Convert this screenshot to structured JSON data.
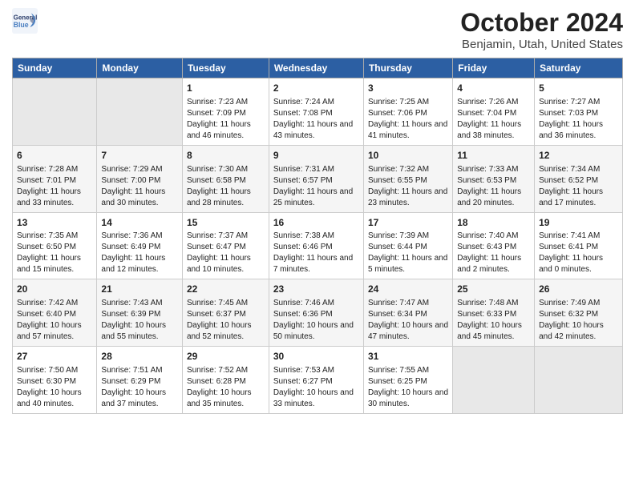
{
  "logo": {
    "text_general": "General",
    "text_blue": "Blue"
  },
  "title": "October 2024",
  "subtitle": "Benjamin, Utah, United States",
  "days_of_week": [
    "Sunday",
    "Monday",
    "Tuesday",
    "Wednesday",
    "Thursday",
    "Friday",
    "Saturday"
  ],
  "weeks": [
    [
      {
        "day": null,
        "sunrise": null,
        "sunset": null,
        "daylight": null
      },
      {
        "day": null,
        "sunrise": null,
        "sunset": null,
        "daylight": null
      },
      {
        "day": "1",
        "sunrise": "Sunrise: 7:23 AM",
        "sunset": "Sunset: 7:09 PM",
        "daylight": "Daylight: 11 hours and 46 minutes."
      },
      {
        "day": "2",
        "sunrise": "Sunrise: 7:24 AM",
        "sunset": "Sunset: 7:08 PM",
        "daylight": "Daylight: 11 hours and 43 minutes."
      },
      {
        "day": "3",
        "sunrise": "Sunrise: 7:25 AM",
        "sunset": "Sunset: 7:06 PM",
        "daylight": "Daylight: 11 hours and 41 minutes."
      },
      {
        "day": "4",
        "sunrise": "Sunrise: 7:26 AM",
        "sunset": "Sunset: 7:04 PM",
        "daylight": "Daylight: 11 hours and 38 minutes."
      },
      {
        "day": "5",
        "sunrise": "Sunrise: 7:27 AM",
        "sunset": "Sunset: 7:03 PM",
        "daylight": "Daylight: 11 hours and 36 minutes."
      }
    ],
    [
      {
        "day": "6",
        "sunrise": "Sunrise: 7:28 AM",
        "sunset": "Sunset: 7:01 PM",
        "daylight": "Daylight: 11 hours and 33 minutes."
      },
      {
        "day": "7",
        "sunrise": "Sunrise: 7:29 AM",
        "sunset": "Sunset: 7:00 PM",
        "daylight": "Daylight: 11 hours and 30 minutes."
      },
      {
        "day": "8",
        "sunrise": "Sunrise: 7:30 AM",
        "sunset": "Sunset: 6:58 PM",
        "daylight": "Daylight: 11 hours and 28 minutes."
      },
      {
        "day": "9",
        "sunrise": "Sunrise: 7:31 AM",
        "sunset": "Sunset: 6:57 PM",
        "daylight": "Daylight: 11 hours and 25 minutes."
      },
      {
        "day": "10",
        "sunrise": "Sunrise: 7:32 AM",
        "sunset": "Sunset: 6:55 PM",
        "daylight": "Daylight: 11 hours and 23 minutes."
      },
      {
        "day": "11",
        "sunrise": "Sunrise: 7:33 AM",
        "sunset": "Sunset: 6:53 PM",
        "daylight": "Daylight: 11 hours and 20 minutes."
      },
      {
        "day": "12",
        "sunrise": "Sunrise: 7:34 AM",
        "sunset": "Sunset: 6:52 PM",
        "daylight": "Daylight: 11 hours and 17 minutes."
      }
    ],
    [
      {
        "day": "13",
        "sunrise": "Sunrise: 7:35 AM",
        "sunset": "Sunset: 6:50 PM",
        "daylight": "Daylight: 11 hours and 15 minutes."
      },
      {
        "day": "14",
        "sunrise": "Sunrise: 7:36 AM",
        "sunset": "Sunset: 6:49 PM",
        "daylight": "Daylight: 11 hours and 12 minutes."
      },
      {
        "day": "15",
        "sunrise": "Sunrise: 7:37 AM",
        "sunset": "Sunset: 6:47 PM",
        "daylight": "Daylight: 11 hours and 10 minutes."
      },
      {
        "day": "16",
        "sunrise": "Sunrise: 7:38 AM",
        "sunset": "Sunset: 6:46 PM",
        "daylight": "Daylight: 11 hours and 7 minutes."
      },
      {
        "day": "17",
        "sunrise": "Sunrise: 7:39 AM",
        "sunset": "Sunset: 6:44 PM",
        "daylight": "Daylight: 11 hours and 5 minutes."
      },
      {
        "day": "18",
        "sunrise": "Sunrise: 7:40 AM",
        "sunset": "Sunset: 6:43 PM",
        "daylight": "Daylight: 11 hours and 2 minutes."
      },
      {
        "day": "19",
        "sunrise": "Sunrise: 7:41 AM",
        "sunset": "Sunset: 6:41 PM",
        "daylight": "Daylight: 11 hours and 0 minutes."
      }
    ],
    [
      {
        "day": "20",
        "sunrise": "Sunrise: 7:42 AM",
        "sunset": "Sunset: 6:40 PM",
        "daylight": "Daylight: 10 hours and 57 minutes."
      },
      {
        "day": "21",
        "sunrise": "Sunrise: 7:43 AM",
        "sunset": "Sunset: 6:39 PM",
        "daylight": "Daylight: 10 hours and 55 minutes."
      },
      {
        "day": "22",
        "sunrise": "Sunrise: 7:45 AM",
        "sunset": "Sunset: 6:37 PM",
        "daylight": "Daylight: 10 hours and 52 minutes."
      },
      {
        "day": "23",
        "sunrise": "Sunrise: 7:46 AM",
        "sunset": "Sunset: 6:36 PM",
        "daylight": "Daylight: 10 hours and 50 minutes."
      },
      {
        "day": "24",
        "sunrise": "Sunrise: 7:47 AM",
        "sunset": "Sunset: 6:34 PM",
        "daylight": "Daylight: 10 hours and 47 minutes."
      },
      {
        "day": "25",
        "sunrise": "Sunrise: 7:48 AM",
        "sunset": "Sunset: 6:33 PM",
        "daylight": "Daylight: 10 hours and 45 minutes."
      },
      {
        "day": "26",
        "sunrise": "Sunrise: 7:49 AM",
        "sunset": "Sunset: 6:32 PM",
        "daylight": "Daylight: 10 hours and 42 minutes."
      }
    ],
    [
      {
        "day": "27",
        "sunrise": "Sunrise: 7:50 AM",
        "sunset": "Sunset: 6:30 PM",
        "daylight": "Daylight: 10 hours and 40 minutes."
      },
      {
        "day": "28",
        "sunrise": "Sunrise: 7:51 AM",
        "sunset": "Sunset: 6:29 PM",
        "daylight": "Daylight: 10 hours and 37 minutes."
      },
      {
        "day": "29",
        "sunrise": "Sunrise: 7:52 AM",
        "sunset": "Sunset: 6:28 PM",
        "daylight": "Daylight: 10 hours and 35 minutes."
      },
      {
        "day": "30",
        "sunrise": "Sunrise: 7:53 AM",
        "sunset": "Sunset: 6:27 PM",
        "daylight": "Daylight: 10 hours and 33 minutes."
      },
      {
        "day": "31",
        "sunrise": "Sunrise: 7:55 AM",
        "sunset": "Sunset: 6:25 PM",
        "daylight": "Daylight: 10 hours and 30 minutes."
      },
      {
        "day": null,
        "sunrise": null,
        "sunset": null,
        "daylight": null
      },
      {
        "day": null,
        "sunrise": null,
        "sunset": null,
        "daylight": null
      }
    ]
  ]
}
